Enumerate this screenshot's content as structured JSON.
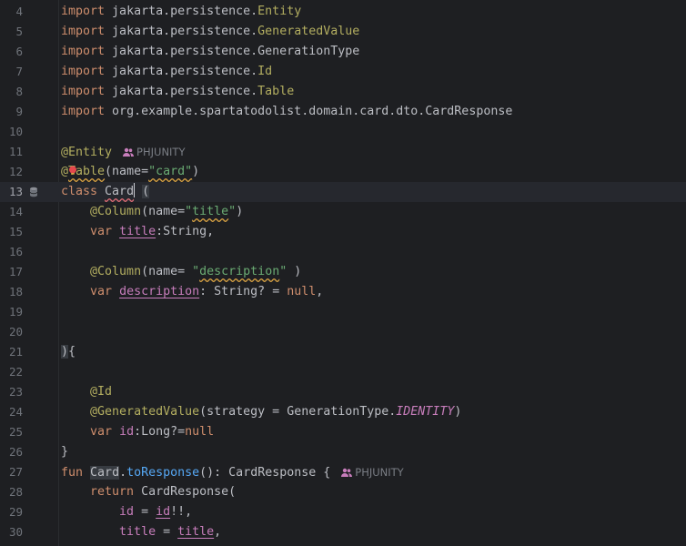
{
  "editor": {
    "author_hint": "PHJUNITY",
    "lines": [
      {
        "n": "4",
        "parts": [
          {
            "c": "kw",
            "t": "import"
          },
          {
            "c": "plain",
            "t": " jakarta.persistence."
          },
          {
            "c": "ann",
            "t": "Entity"
          }
        ]
      },
      {
        "n": "5",
        "parts": [
          {
            "c": "kw",
            "t": "import"
          },
          {
            "c": "plain",
            "t": " jakarta.persistence."
          },
          {
            "c": "ann",
            "t": "GeneratedValue"
          }
        ]
      },
      {
        "n": "6",
        "parts": [
          {
            "c": "kw",
            "t": "import"
          },
          {
            "c": "plain",
            "t": " jakarta.persistence.GenerationType"
          }
        ]
      },
      {
        "n": "7",
        "parts": [
          {
            "c": "kw",
            "t": "import"
          },
          {
            "c": "plain",
            "t": " jakarta.persistence."
          },
          {
            "c": "ann",
            "t": "Id"
          }
        ]
      },
      {
        "n": "8",
        "parts": [
          {
            "c": "kw",
            "t": "import"
          },
          {
            "c": "plain",
            "t": " jakarta.persistence."
          },
          {
            "c": "ann",
            "t": "Table"
          }
        ]
      },
      {
        "n": "9",
        "parts": [
          {
            "c": "kw",
            "t": "import"
          },
          {
            "c": "plain",
            "t": " org.example.spartatodolist.domain.card.dto.CardResponse"
          }
        ]
      },
      {
        "n": "10",
        "parts": []
      },
      {
        "n": "11",
        "parts": [
          {
            "c": "ann",
            "t": "@Entity"
          }
        ],
        "hint": true
      },
      {
        "n": "12",
        "bulb": true,
        "parts": [
          {
            "c": "ann",
            "t": "@"
          },
          {
            "c": "ann warn",
            "t": "Table"
          },
          {
            "c": "plain",
            "t": "(name="
          },
          {
            "c": "str warn",
            "t": "\"card\""
          },
          {
            "c": "plain",
            "t": ")"
          }
        ]
      },
      {
        "n": "13",
        "current": true,
        "db_icon": true,
        "parts": [
          {
            "c": "kw",
            "t": "class"
          },
          {
            "c": "plain",
            "t": " "
          },
          {
            "c": "plain err",
            "t": "Card"
          },
          {
            "c": "caret",
            "t": ""
          },
          {
            "c": "plain",
            "t": " "
          },
          {
            "c": "plain hl",
            "t": "("
          }
        ]
      },
      {
        "n": "14",
        "parts": [
          {
            "c": "plain",
            "t": "    "
          },
          {
            "c": "ann",
            "t": "@Column"
          },
          {
            "c": "plain",
            "t": "(name="
          },
          {
            "c": "str",
            "t": "\""
          },
          {
            "c": "str warn",
            "t": "title"
          },
          {
            "c": "str",
            "t": "\""
          },
          {
            "c": "plain",
            "t": ")"
          }
        ]
      },
      {
        "n": "15",
        "parts": [
          {
            "c": "plain",
            "t": "    "
          },
          {
            "c": "kw",
            "t": "var"
          },
          {
            "c": "plain",
            "t": " "
          },
          {
            "c": "prop-u",
            "t": "title"
          },
          {
            "c": "plain",
            "t": ":String,"
          }
        ]
      },
      {
        "n": "16",
        "parts": []
      },
      {
        "n": "17",
        "parts": [
          {
            "c": "plain",
            "t": "    "
          },
          {
            "c": "ann",
            "t": "@Column"
          },
          {
            "c": "plain",
            "t": "(name= "
          },
          {
            "c": "str",
            "t": "\""
          },
          {
            "c": "str warn",
            "t": "description"
          },
          {
            "c": "str",
            "t": "\""
          },
          {
            "c": "plain",
            "t": " )"
          }
        ]
      },
      {
        "n": "18",
        "parts": [
          {
            "c": "plain",
            "t": "    "
          },
          {
            "c": "kw",
            "t": "var"
          },
          {
            "c": "plain",
            "t": " "
          },
          {
            "c": "prop-u",
            "t": "description"
          },
          {
            "c": "plain",
            "t": ": String? = "
          },
          {
            "c": "kw",
            "t": "null"
          },
          {
            "c": "plain",
            "t": ","
          }
        ]
      },
      {
        "n": "19",
        "parts": []
      },
      {
        "n": "20",
        "parts": []
      },
      {
        "n": "21",
        "parts": [
          {
            "c": "plain hl",
            "t": ")"
          },
          {
            "c": "plain",
            "t": "{"
          }
        ]
      },
      {
        "n": "22",
        "parts": []
      },
      {
        "n": "23",
        "parts": [
          {
            "c": "plain",
            "t": "    "
          },
          {
            "c": "ann",
            "t": "@Id"
          }
        ]
      },
      {
        "n": "24",
        "parts": [
          {
            "c": "plain",
            "t": "    "
          },
          {
            "c": "ann",
            "t": "@GeneratedValue"
          },
          {
            "c": "plain",
            "t": "(strategy = GenerationType."
          },
          {
            "c": "ital",
            "t": "IDENTITY"
          },
          {
            "c": "plain",
            "t": ")"
          }
        ]
      },
      {
        "n": "25",
        "parts": [
          {
            "c": "plain",
            "t": "    "
          },
          {
            "c": "kw",
            "t": "var"
          },
          {
            "c": "plain",
            "t": " "
          },
          {
            "c": "prop",
            "t": "id"
          },
          {
            "c": "plain",
            "t": ":Long?="
          },
          {
            "c": "kw",
            "t": "null"
          }
        ]
      },
      {
        "n": "26",
        "parts": [
          {
            "c": "plain",
            "t": "}"
          }
        ]
      },
      {
        "n": "27",
        "parts": [
          {
            "c": "kw",
            "t": "fun"
          },
          {
            "c": "plain",
            "t": " "
          },
          {
            "c": "plain hl",
            "t": "Card"
          },
          {
            "c": "plain",
            "t": "."
          },
          {
            "c": "fn",
            "t": "toResponse"
          },
          {
            "c": "plain",
            "t": "(): CardResponse {"
          }
        ],
        "hint": true
      },
      {
        "n": "28",
        "parts": [
          {
            "c": "plain",
            "t": "    "
          },
          {
            "c": "kw",
            "t": "return"
          },
          {
            "c": "plain",
            "t": " CardResponse("
          }
        ]
      },
      {
        "n": "29",
        "parts": [
          {
            "c": "plain",
            "t": "        "
          },
          {
            "c": "prop",
            "t": "id"
          },
          {
            "c": "plain",
            "t": " = "
          },
          {
            "c": "prop-u",
            "t": "id"
          },
          {
            "c": "plain",
            "t": "!!,"
          }
        ]
      },
      {
        "n": "30",
        "parts": [
          {
            "c": "plain",
            "t": "        "
          },
          {
            "c": "prop",
            "t": "title"
          },
          {
            "c": "plain",
            "t": " = "
          },
          {
            "c": "prop-u",
            "t": "title"
          },
          {
            "c": "plain",
            "t": ","
          }
        ]
      }
    ]
  }
}
